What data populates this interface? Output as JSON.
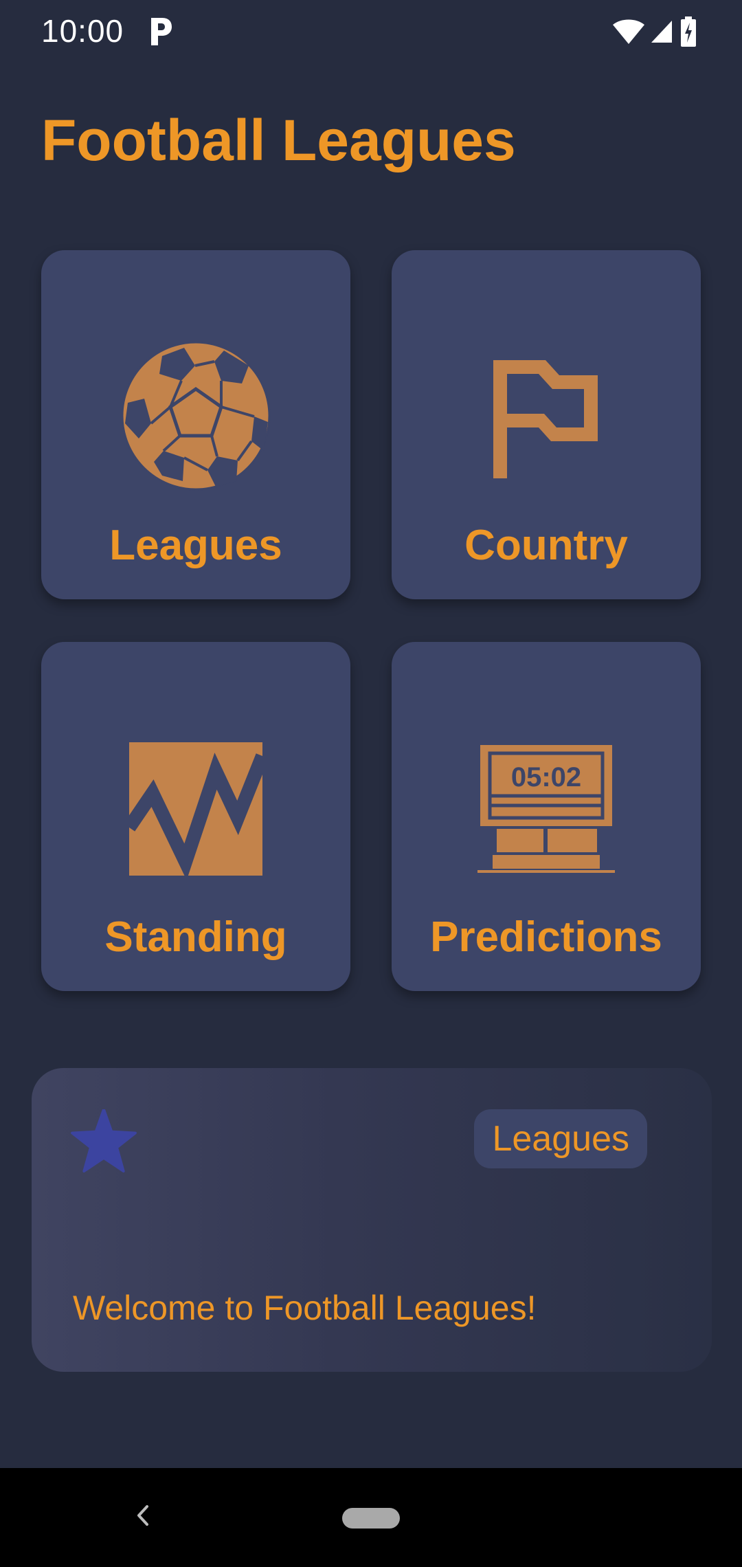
{
  "status_bar": {
    "time": "10:00",
    "icons": [
      "parking-app-icon",
      "wifi-icon",
      "cellular-signal-icon",
      "battery-charging-icon"
    ]
  },
  "header": {
    "title": "Football Leagues"
  },
  "tiles": [
    {
      "label": "Leagues",
      "icon": "soccer-ball-icon"
    },
    {
      "label": "Country",
      "icon": "flag-icon"
    },
    {
      "label": "Standing",
      "icon": "chart-icon"
    },
    {
      "label": "Predictions",
      "icon": "scoreboard-icon",
      "icon_text": "05:02"
    }
  ],
  "banner": {
    "icon": "star-icon",
    "chip_label": "Leagues",
    "message": "Welcome to Football Leagues!"
  },
  "colors": {
    "background": "#262c3f",
    "tile": "#3d4568",
    "accent": "#ee9727",
    "icon_fill": "#c3834b",
    "star": "#3c44a0"
  },
  "nav_bar": {
    "buttons": [
      "back-icon",
      "home-pill"
    ]
  }
}
